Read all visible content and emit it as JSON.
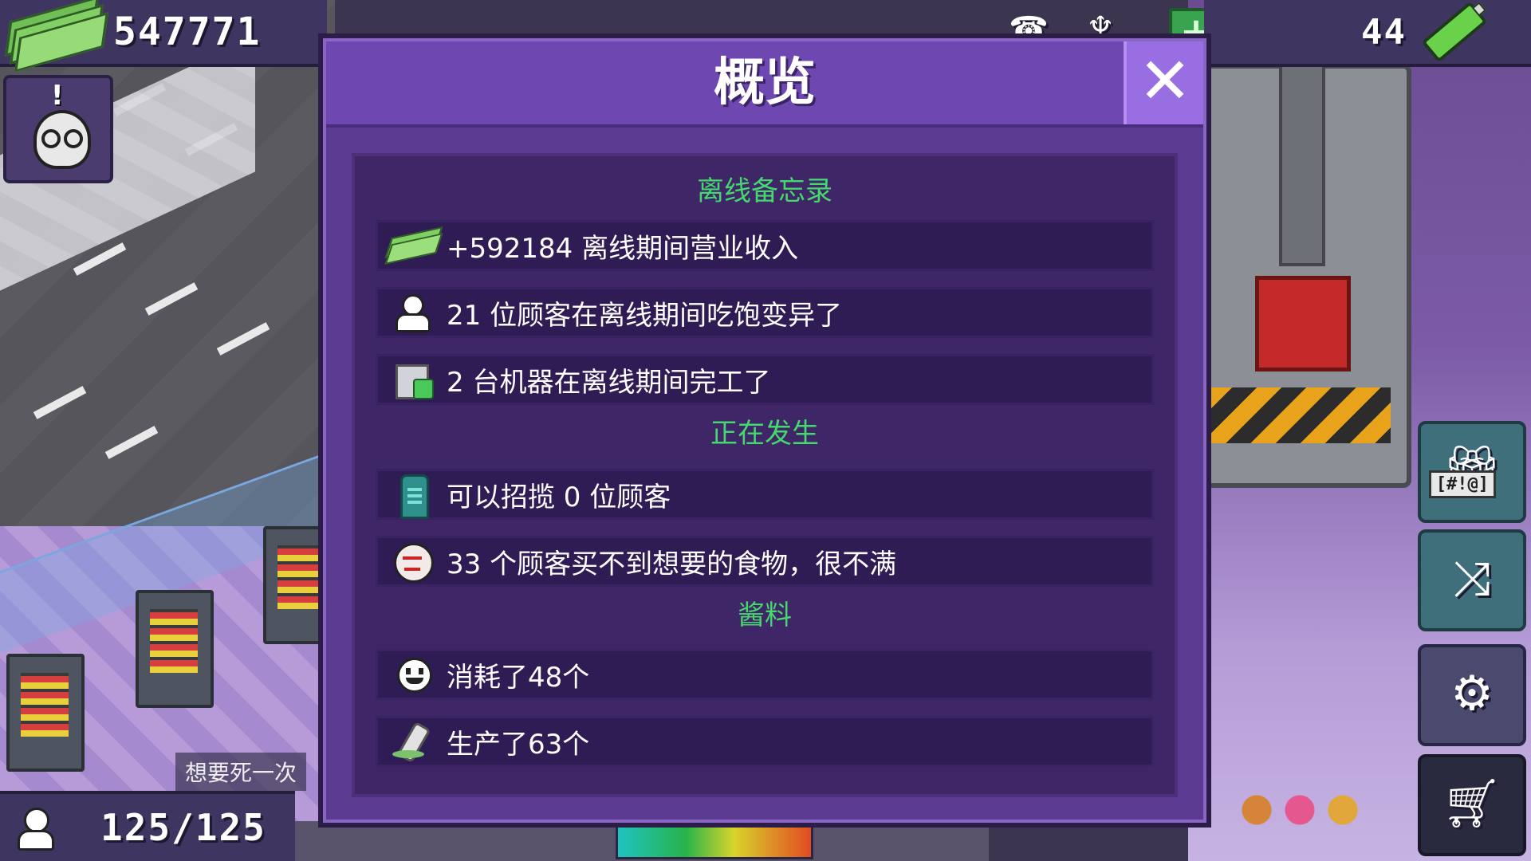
{
  "hud": {
    "money": "547771",
    "energy": "44",
    "customers": "125/125",
    "add_button": "+"
  },
  "background": {
    "tip_text": "想要死一次"
  },
  "side_buttons": {
    "gift_label": "[#!@]"
  },
  "dialog": {
    "title": "概览",
    "close_symbol": "✕",
    "sections": [
      {
        "title": "离线备忘录",
        "rows": [
          {
            "icon": "cash-icon",
            "text": "+592184 离线期间营业收入"
          },
          {
            "icon": "customer-icon",
            "text": "21 位顾客在离线期间吃饱变异了"
          },
          {
            "icon": "machine-icon",
            "text": "2 台机器在离线期间完工了"
          }
        ]
      },
      {
        "title": "正在发生",
        "rows": [
          {
            "icon": "phone-booth-icon",
            "text": "可以招揽 0 位顾客"
          },
          {
            "icon": "angry-face-icon",
            "text": "33 个顾客买不到想要的食物，很不满"
          }
        ]
      },
      {
        "title": "酱料",
        "rows": [
          {
            "icon": "smiley-icon",
            "text": "消耗了48个"
          },
          {
            "icon": "sauce-bottle-icon",
            "text": "生产了63个"
          }
        ]
      }
    ]
  },
  "colors": {
    "dialog_bg": "#5b3b92",
    "header_bg": "#6e48b0",
    "close_bg": "#9a6ee3",
    "section_title": "#45d86f",
    "row_bg": "#301c55"
  }
}
